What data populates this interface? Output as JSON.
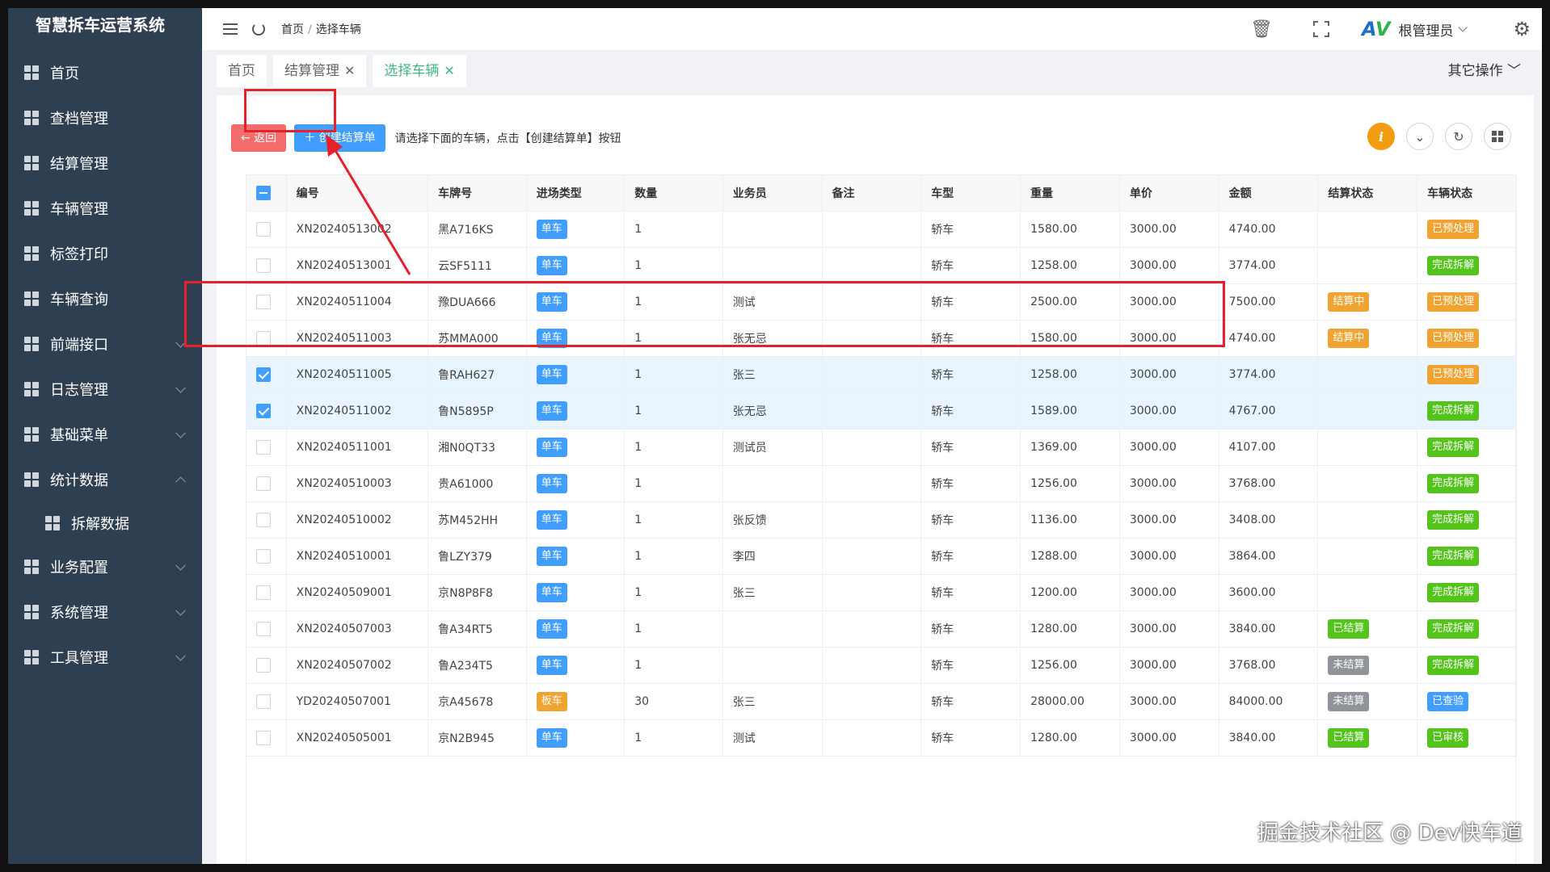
{
  "app": {
    "brand": "智慧拆车运营系统"
  },
  "sidebar": {
    "items": [
      {
        "label": "首页",
        "name": "sidebar-item-home",
        "chevron": ""
      },
      {
        "label": "查档管理",
        "name": "sidebar-item-archive",
        "chevron": ""
      },
      {
        "label": "结算管理",
        "name": "sidebar-item-settlement",
        "chevron": ""
      },
      {
        "label": "车辆管理",
        "name": "sidebar-item-vehicle",
        "chevron": ""
      },
      {
        "label": "标签打印",
        "name": "sidebar-item-label-print",
        "chevron": ""
      },
      {
        "label": "车辆查询",
        "name": "sidebar-item-vehicle-query",
        "chevron": ""
      },
      {
        "label": "前端接口",
        "name": "sidebar-item-frontend-api",
        "chevron": "down"
      },
      {
        "label": "日志管理",
        "name": "sidebar-item-logs",
        "chevron": "down"
      },
      {
        "label": "基础菜单",
        "name": "sidebar-item-basic-menu",
        "chevron": "down"
      },
      {
        "label": "统计数据",
        "name": "sidebar-item-statistics",
        "chevron": "up"
      },
      {
        "label": "拆解数据",
        "name": "sidebar-item-dismantle-data",
        "chevron": "",
        "sub": true
      },
      {
        "label": "业务配置",
        "name": "sidebar-item-business-config",
        "chevron": "down"
      },
      {
        "label": "系统管理",
        "name": "sidebar-item-system",
        "chevron": "down"
      },
      {
        "label": "工具管理",
        "name": "sidebar-item-tools",
        "chevron": "down"
      }
    ]
  },
  "header": {
    "breadcrumb": [
      "首页",
      "选择车辆"
    ],
    "breadcrumb_sep": "/",
    "user": "根管理员",
    "logo_a": "A",
    "logo_v": "V"
  },
  "tabs": [
    {
      "label": "首页",
      "closable": false,
      "active": false
    },
    {
      "label": "结算管理",
      "closable": true,
      "active": false
    },
    {
      "label": "选择车辆",
      "closable": true,
      "active": true
    }
  ],
  "other_ops": "其它操作",
  "toolbar": {
    "back_label": "← 返回",
    "create_label": "＋ 创建结算单",
    "hint": "请选择下面的车辆，点击【创建结算单】按钮"
  },
  "table": {
    "columns": [
      "编号",
      "车牌号",
      "进场类型",
      "数量",
      "业务员",
      "备注",
      "车型",
      "重量",
      "单价",
      "金额",
      "结算状态",
      "车辆状态"
    ],
    "rows": [
      {
        "checked": false,
        "cells": [
          "XN20240513002",
          "黑A716KS",
          "单车",
          "1",
          "",
          "",
          "轿车",
          "1580.00",
          "3000.00",
          "4740.00",
          "",
          "已预处理"
        ]
      },
      {
        "checked": false,
        "cells": [
          "XN20240513001",
          "云SF5111",
          "单车",
          "1",
          "",
          "",
          "轿车",
          "1258.00",
          "3000.00",
          "3774.00",
          "",
          "完成拆解"
        ]
      },
      {
        "checked": false,
        "cells": [
          "XN20240511004",
          "豫DUA666",
          "单车",
          "1",
          "测试",
          "",
          "轿车",
          "2500.00",
          "3000.00",
          "7500.00",
          "结算中",
          "已预处理"
        ]
      },
      {
        "checked": false,
        "cells": [
          "XN20240511003",
          "苏MMA000",
          "单车",
          "1",
          "张无忌",
          "",
          "轿车",
          "1580.00",
          "3000.00",
          "4740.00",
          "结算中",
          "已预处理"
        ]
      },
      {
        "checked": true,
        "cells": [
          "XN20240511005",
          "鲁RAH627",
          "单车",
          "1",
          "张三",
          "",
          "轿车",
          "1258.00",
          "3000.00",
          "3774.00",
          "",
          "已预处理"
        ]
      },
      {
        "checked": true,
        "cells": [
          "XN20240511002",
          "鲁N5895P",
          "单车",
          "1",
          "张无忌",
          "",
          "轿车",
          "1589.00",
          "3000.00",
          "4767.00",
          "",
          "完成拆解"
        ]
      },
      {
        "checked": false,
        "cells": [
          "XN20240511001",
          "湘N0QT33",
          "单车",
          "1",
          "测试员",
          "",
          "轿车",
          "1369.00",
          "3000.00",
          "4107.00",
          "",
          "完成拆解"
        ]
      },
      {
        "checked": false,
        "cells": [
          "XN20240510003",
          "贵A61000",
          "单车",
          "1",
          "",
          "",
          "轿车",
          "1256.00",
          "3000.00",
          "3768.00",
          "",
          "完成拆解"
        ]
      },
      {
        "checked": false,
        "cells": [
          "XN20240510002",
          "苏M452HH",
          "单车",
          "1",
          "张反馈",
          "",
          "轿车",
          "1136.00",
          "3000.00",
          "3408.00",
          "",
          "完成拆解"
        ]
      },
      {
        "checked": false,
        "cells": [
          "XN20240510001",
          "鲁LZY379",
          "单车",
          "1",
          "李四",
          "",
          "轿车",
          "1288.00",
          "3000.00",
          "3864.00",
          "",
          "完成拆解"
        ]
      },
      {
        "checked": false,
        "cells": [
          "XN20240509001",
          "京N8P8F8",
          "单车",
          "1",
          "张三",
          "",
          "轿车",
          "1200.00",
          "3000.00",
          "3600.00",
          "",
          "完成拆解"
        ]
      },
      {
        "checked": false,
        "cells": [
          "XN20240507003",
          "鲁A34RT5",
          "单车",
          "1",
          "",
          "",
          "轿车",
          "1280.00",
          "3000.00",
          "3840.00",
          "已结算",
          "完成拆解"
        ]
      },
      {
        "checked": false,
        "cells": [
          "XN20240507002",
          "鲁A234T5",
          "单车",
          "1",
          "",
          "",
          "轿车",
          "1256.00",
          "3000.00",
          "3768.00",
          "未结算",
          "完成拆解"
        ]
      },
      {
        "checked": false,
        "cells": [
          "YD20240507001",
          "京A45678",
          "板车",
          "30",
          "张三",
          "",
          "轿车",
          "28000.00",
          "3000.00",
          "84000.00",
          "未结算",
          "已查验"
        ]
      },
      {
        "checked": false,
        "cells": [
          "XN20240505001",
          "京N2B945",
          "单车",
          "1",
          "测试",
          "",
          "轿车",
          "1280.00",
          "3000.00",
          "3840.00",
          "已结算",
          "已审核"
        ]
      }
    ]
  },
  "tag_colors": {
    "单车": "#409eff",
    "板车": "#f0a331",
    "结算中": "#f0a331",
    "已结算": "#52c41a",
    "未结算": "#909399",
    "已预处理": "#f0a331",
    "完成拆解": "#52c41a",
    "已查验": "#409eff",
    "已审核": "#52c41a"
  },
  "colors": {
    "sidebar_bg": "#2f3f52",
    "accent": "#409eff",
    "annotation": "#e8202a",
    "active_tab": "#42b883"
  },
  "watermark": "掘金技术社区 @ Dev快车道"
}
